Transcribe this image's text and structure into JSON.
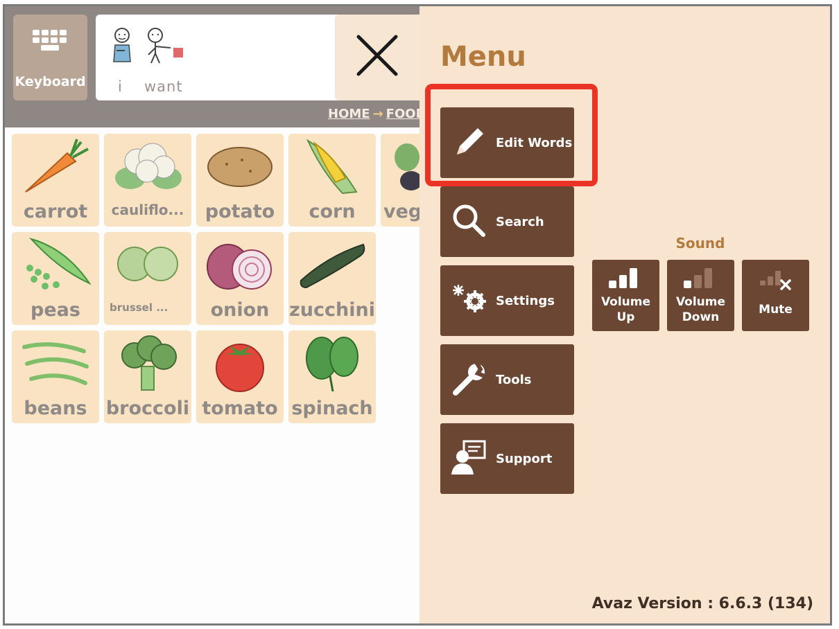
{
  "toolbar": {
    "keyboard_label": "Keyboard",
    "sentence_words": [
      "i",
      "want"
    ],
    "breadcrumb": [
      "HOME",
      "FOOD"
    ]
  },
  "grid": {
    "tiles": [
      {
        "label": "carrot",
        "icon": "carrot-icon"
      },
      {
        "label": "cauliflo...",
        "icon": "cauliflower-icon"
      },
      {
        "label": "potato",
        "icon": "potato-icon"
      },
      {
        "label": "corn",
        "icon": "corn-icon"
      },
      {
        "label": "vege",
        "icon": "vegetables-icon"
      },
      {
        "label": "peas",
        "icon": "peas-icon"
      },
      {
        "label": "brussel ...",
        "icon": "brussel-sprouts-icon"
      },
      {
        "label": "onion",
        "icon": "onion-icon"
      },
      {
        "label": "zucchini",
        "icon": "zucchini-icon"
      },
      {
        "label": "beans",
        "icon": "beans-icon"
      },
      {
        "label": "broccoli",
        "icon": "broccoli-icon"
      },
      {
        "label": "tomato",
        "icon": "tomato-icon"
      },
      {
        "label": "spinach",
        "icon": "spinach-icon"
      }
    ]
  },
  "menu": {
    "title": "Menu",
    "items": [
      {
        "label": "Edit Words",
        "icon": "pencil-icon"
      },
      {
        "label": "Search",
        "icon": "search-icon"
      },
      {
        "label": "Settings",
        "icon": "gear-icon"
      },
      {
        "label": "Tools",
        "icon": "wrench-icon"
      },
      {
        "label": "Support",
        "icon": "support-icon"
      }
    ],
    "sound": {
      "title": "Sound",
      "buttons": [
        {
          "label_line1": "Volume",
          "label_line2": "Up",
          "icon": "volume-up-icon"
        },
        {
          "label_line1": "Volume",
          "label_line2": "Down",
          "icon": "volume-down-icon"
        },
        {
          "label_line1": "Mute",
          "label_line2": "",
          "icon": "mute-icon"
        }
      ]
    },
    "version": "Avaz Version : 6.6.3 (134)"
  },
  "colors": {
    "menu_bg": "#f9e4d0",
    "menu_button": "#6b4733",
    "menu_title": "#b27a3c",
    "highlight": "#ea3324",
    "tile_bg": "#f9e3c2",
    "topbar": "#8e8783"
  }
}
